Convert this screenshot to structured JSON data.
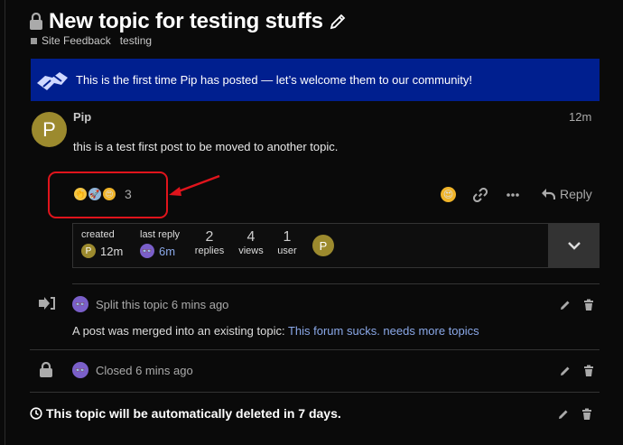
{
  "topic": {
    "title": "New topic for testing stuffs",
    "category": "Site Feedback",
    "tag": "testing"
  },
  "banner": {
    "text": "This is the first time Pip has posted — let’s welcome them to our community!"
  },
  "post": {
    "avatar_letter": "P",
    "username": "Pip",
    "time": "12m",
    "body": "this is a test first post to be moved to another topic.",
    "reaction_count": "3",
    "reply_label": "Reply"
  },
  "stats": {
    "created_label": "created",
    "created_time": "12m",
    "created_avatar_letter": "P",
    "last_reply_label": "last reply",
    "last_reply_time": "6m",
    "replies_num": "2",
    "replies_label": "replies",
    "views_num": "4",
    "views_label": "views",
    "users_num": "1",
    "users_label": "user",
    "participant_letter": "P"
  },
  "small_actions": {
    "split_text": "Split this topic 6 mins ago",
    "merge_prefix": "A post was merged into an existing topic: ",
    "merge_link": "This forum sucks. needs more topics",
    "closed_text": "Closed 6 mins ago",
    "auto_delete_text": "This topic will be automatically deleted in 7 days."
  },
  "colors": {
    "background": "#0a0a0a",
    "banner": "#001f8f",
    "link": "#8aa8e8",
    "highlight": "#e0141c",
    "avatar": "#9c8a2e"
  },
  "icons": [
    "lock-icon",
    "pencil-icon",
    "welcome-hands-icon",
    "heart-eyes-emoji-icon",
    "link-icon",
    "ellipsis-icon",
    "reply-icon",
    "chevron-down-icon",
    "split-arrow-icon",
    "trash-icon",
    "clock-icon"
  ]
}
